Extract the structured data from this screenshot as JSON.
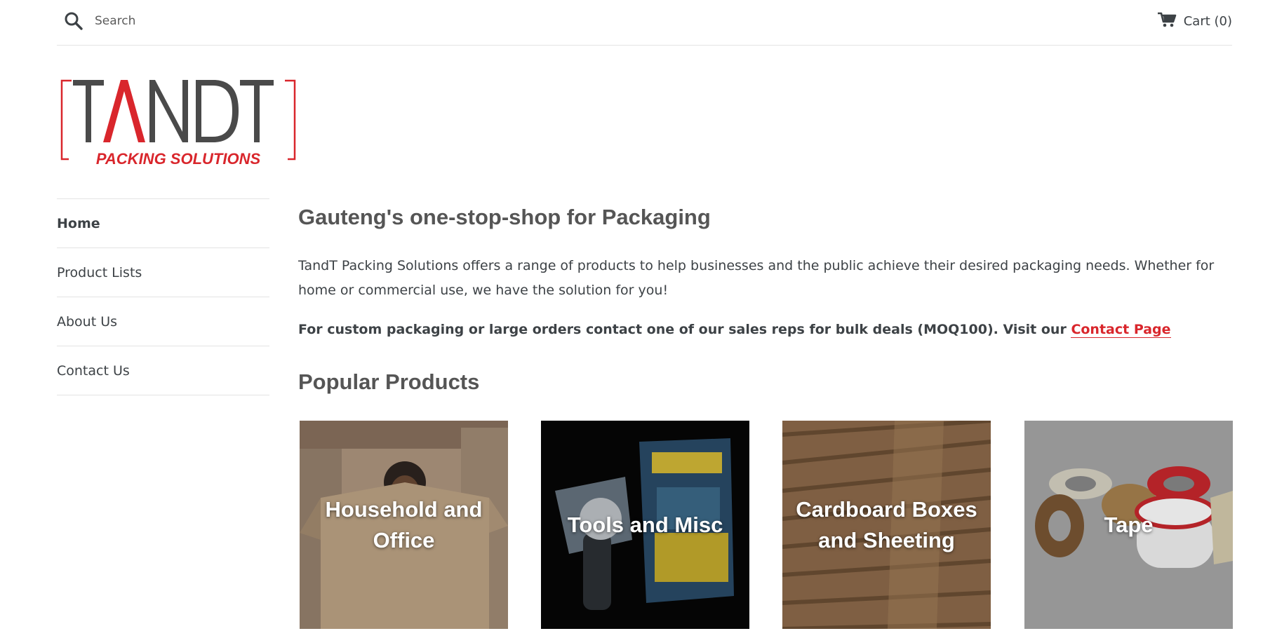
{
  "header": {
    "search_placeholder": "Search",
    "cart_label": "Cart (0)",
    "icons": {
      "search": "search-icon",
      "cart": "cart-icon"
    }
  },
  "logo": {
    "wordmark": "TANDT",
    "tagline": "PACKING SOLUTIONS",
    "colors": {
      "dark": "#4a4a4a",
      "red": "#d9262c"
    }
  },
  "sidebar": {
    "items": [
      {
        "label": "Home",
        "active": true
      },
      {
        "label": "Product Lists"
      },
      {
        "label": "About Us"
      },
      {
        "label": "Contact Us"
      }
    ]
  },
  "main": {
    "headline": "Gauteng's one-stop-shop for Packaging",
    "intro": "TandT Packing Solutions offers a range of products to help businesses and the public achieve their desired packaging needs. Whether for home or commercial use, we have the solution for you!",
    "custom_text": "For custom packaging or large orders contact one of our sales reps for bulk deals (MOQ100). Visit our ",
    "contact_link": "Contact Page",
    "section_title": "Popular Products"
  },
  "products": [
    {
      "label": "Household and Office"
    },
    {
      "label": "Tools and Misc"
    },
    {
      "label": "Cardboard Boxes and Sheeting"
    },
    {
      "label": "Tape"
    }
  ],
  "colors": {
    "accent": "#d9262c",
    "text": "#3d4246",
    "heading": "#555555",
    "divider": "#e4e4e4"
  }
}
